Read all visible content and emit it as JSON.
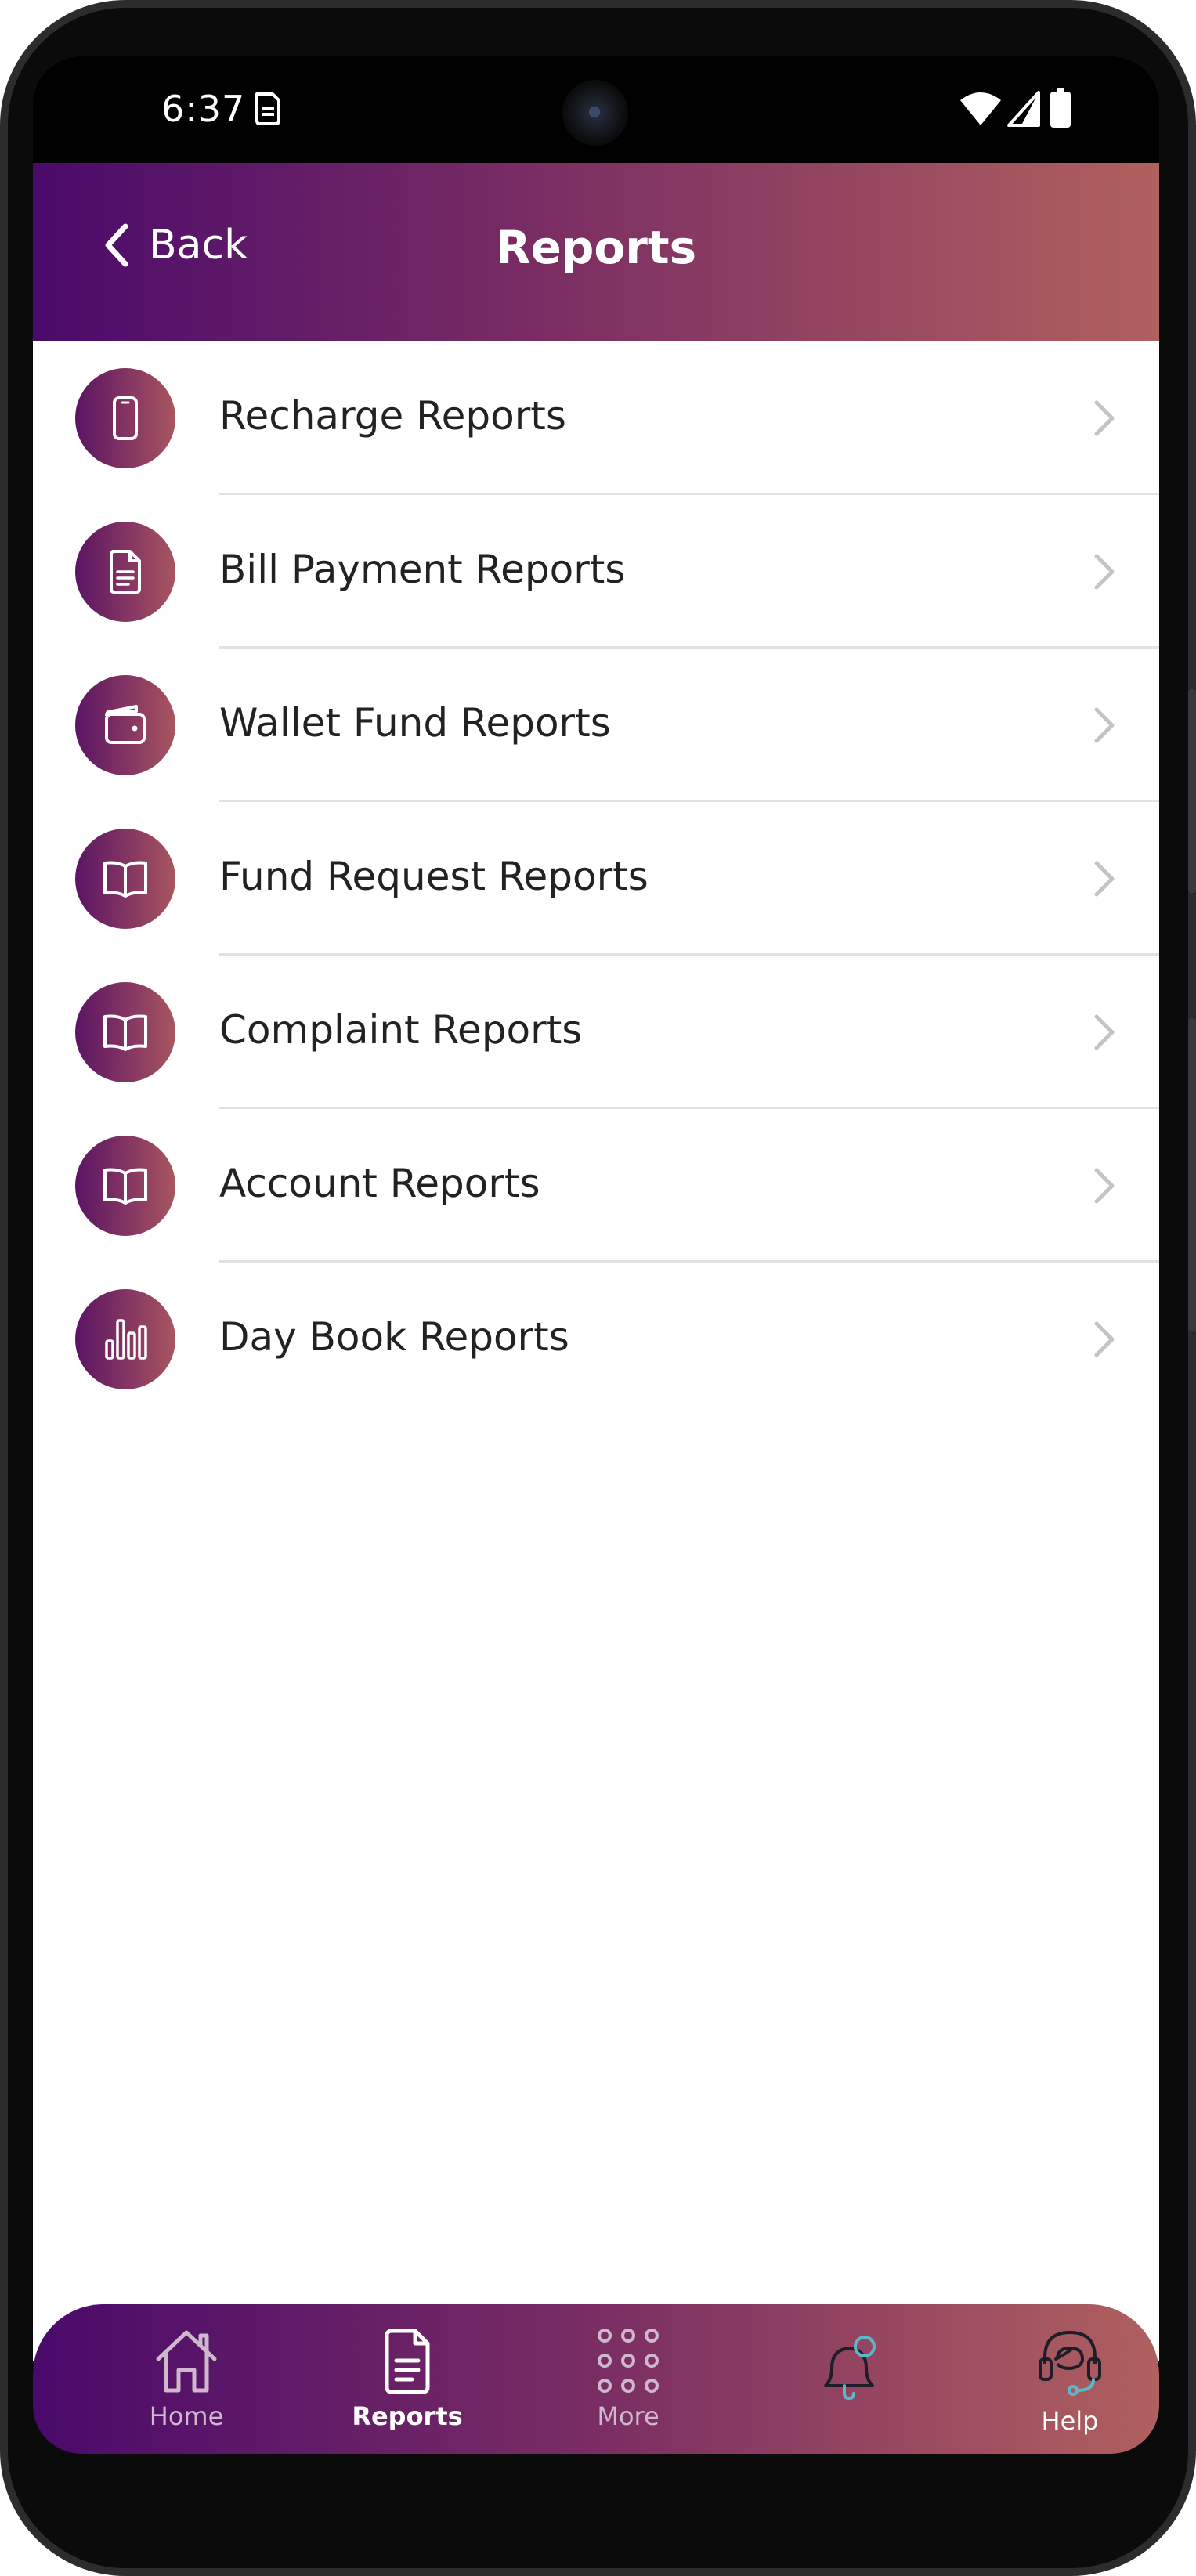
{
  "status_bar": {
    "time": "6:37"
  },
  "header": {
    "back_label": "Back",
    "title": "Reports"
  },
  "reports": [
    {
      "label": "Recharge Reports",
      "icon": "smartphone-icon"
    },
    {
      "label": "Bill Payment Reports",
      "icon": "document-icon"
    },
    {
      "label": "Wallet Fund Reports",
      "icon": "wallet-icon"
    },
    {
      "label": "Fund Request Reports",
      "icon": "book-open-icon"
    },
    {
      "label": "Complaint Reports",
      "icon": "book-open-icon"
    },
    {
      "label": "Account Reports",
      "icon": "book-open-icon"
    },
    {
      "label": "Day Book Reports",
      "icon": "bar-chart-icon"
    }
  ],
  "bottom_nav": {
    "items": [
      {
        "label": "Home",
        "icon": "home-icon",
        "active": false
      },
      {
        "label": "Reports",
        "icon": "reports-document-icon",
        "active": true
      },
      {
        "label": "More",
        "icon": "grid-dots-icon",
        "active": false
      },
      {
        "label": "",
        "icon": "notification-bell-icon",
        "active": false
      },
      {
        "label": "Help",
        "icon": "headset-support-icon",
        "active": false
      }
    ]
  },
  "colors": {
    "gradient_start": "#4a0a6b",
    "gradient_end": "#b0605e",
    "icon_accent": "#5bb8c9",
    "text_primary": "#222222",
    "chevron": "#c4c4c4",
    "divider": "#e1e1e1"
  }
}
